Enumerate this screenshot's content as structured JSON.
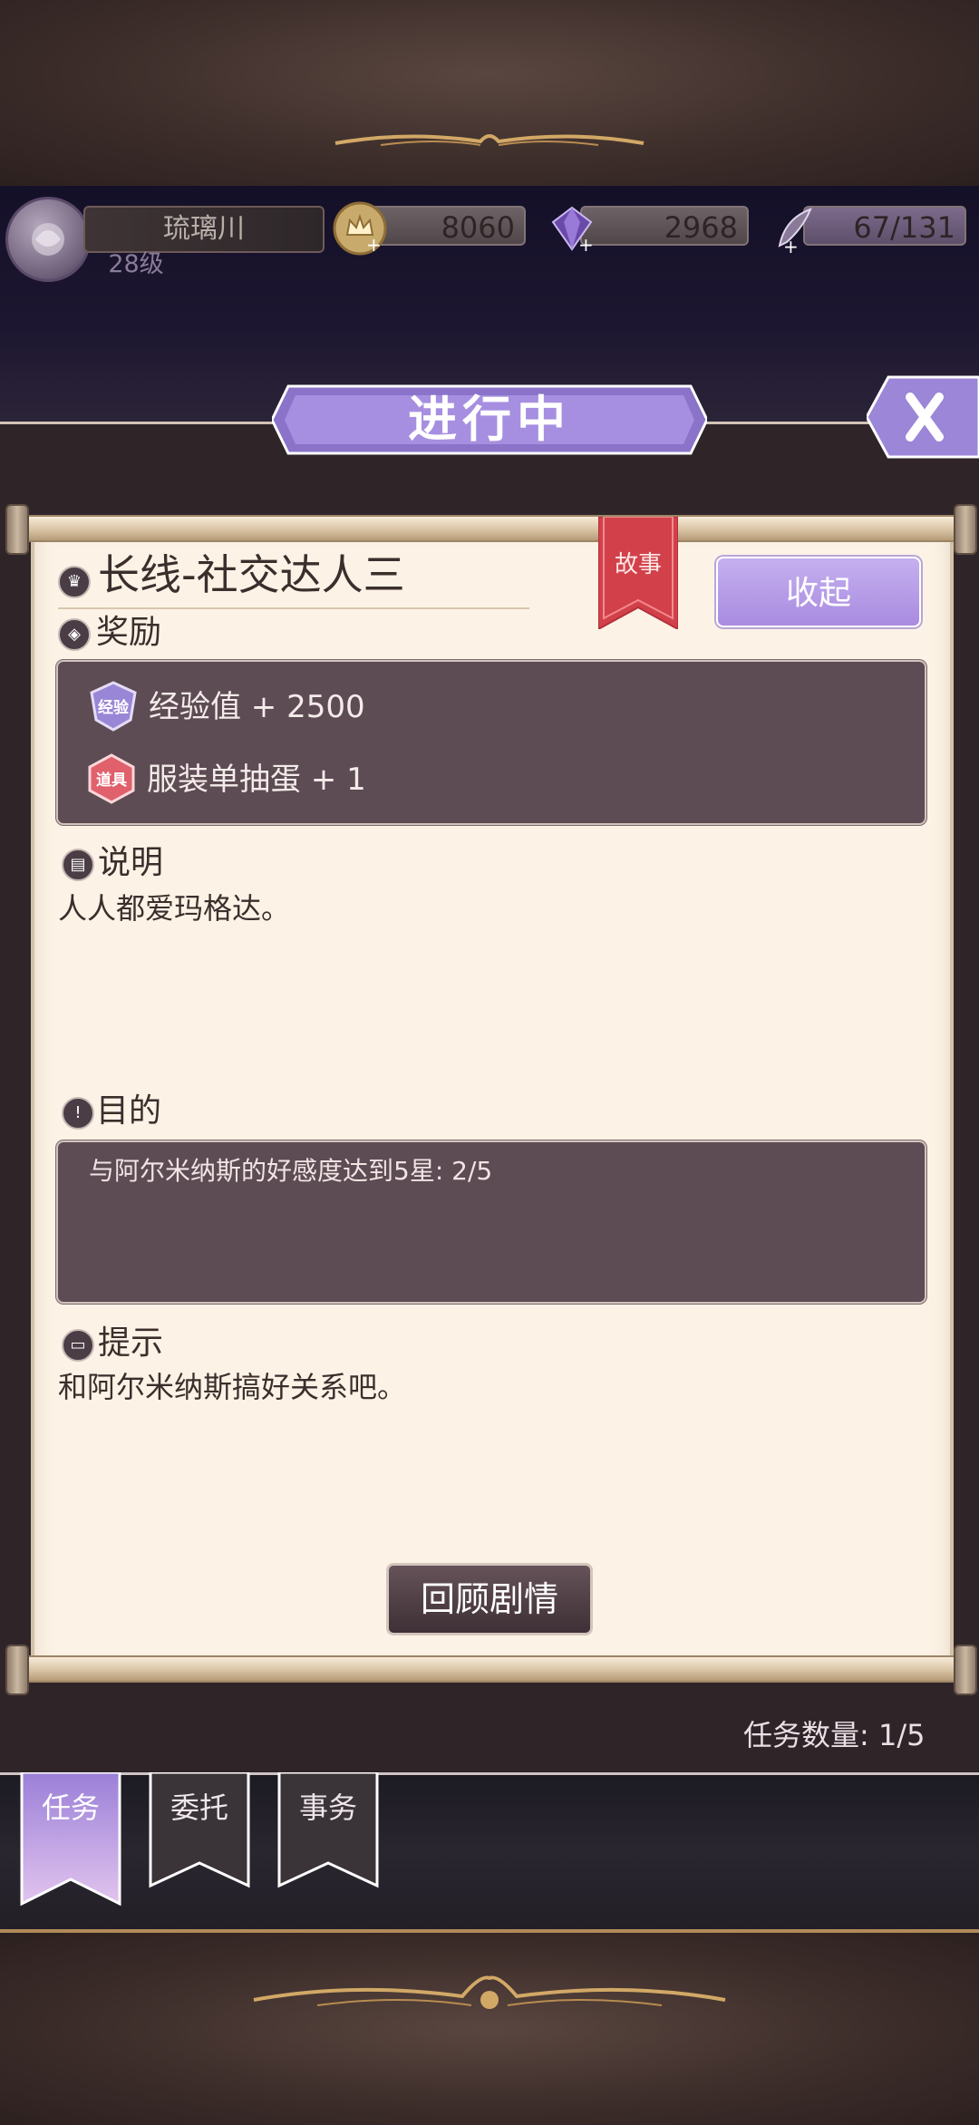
{
  "hud": {
    "player_name": "琉璃川",
    "player_level": "28级",
    "gold": "8060",
    "gems": "2968",
    "stamina": "67/131"
  },
  "panel": {
    "status_title": "进行中",
    "task_title": "长线-社交达人三",
    "task_type_tag": "故事",
    "collapse_label": "收起",
    "rewards_label": "奖励",
    "rewards": [
      {
        "badge": "经验",
        "text": "经验值 + 2500",
        "badge_color": "#9a86d6"
      },
      {
        "badge": "道具",
        "text": "服装单抽蛋 + 1",
        "badge_color": "#e0606c"
      }
    ],
    "description_label": "说明",
    "description": "人人都爱玛格达。",
    "goal_label": "目的",
    "goal": "与阿尔米纳斯的好感度达到5星: 2/5",
    "hint_label": "提示",
    "hint": "和阿尔米纳斯搞好关系吧。",
    "review_label": "回顾剧情",
    "task_count": "任务数量: 1/5"
  },
  "tabs": [
    {
      "label": "任务",
      "active": true
    },
    {
      "label": "委托",
      "active": false
    },
    {
      "label": "事务",
      "active": false
    }
  ],
  "colors": {
    "accent_purple": "#a98be0",
    "parchment": "#fcf3e6",
    "dark_box": "#5d4c53",
    "ribbon_red": "#d2414a"
  }
}
